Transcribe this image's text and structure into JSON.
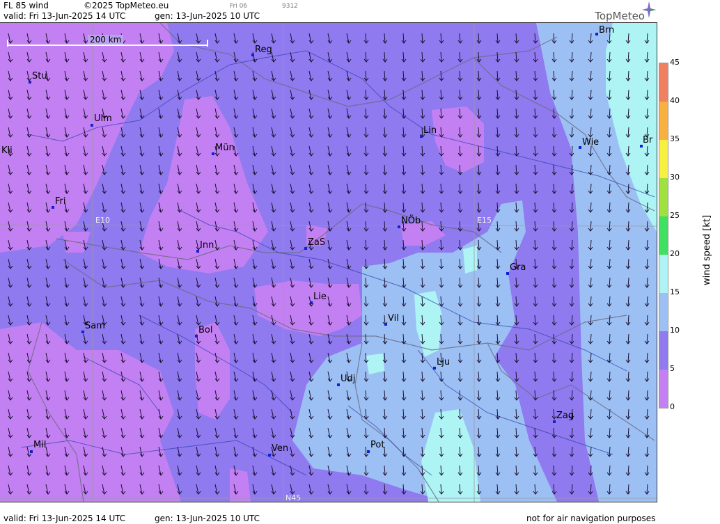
{
  "header": {
    "title": "FL 85 wind",
    "copyright": "©2025 TopMeteo.eu",
    "day_small": "Fri 06",
    "code_small": "9312",
    "valid": "valid:  Fri  13-Jun-2025  14 UTC",
    "gen": "gen: 13-Jun-2025 10 UTC",
    "brand": "TopMeteo"
  },
  "footer": {
    "valid": "valid:  Fri  13-Jun-2025  14 UTC",
    "gen": "gen: 13-Jun-2025 10 UTC",
    "disclaimer": "not for air navigation purposes"
  },
  "map": {
    "scale_label": "200 km",
    "grid_labels": {
      "e10": "E10",
      "e15": "E15",
      "n45": "N45"
    },
    "cities": [
      {
        "name": "Brn"
      },
      {
        "name": "Reg"
      },
      {
        "name": "Stu"
      },
      {
        "name": "Ulm"
      },
      {
        "name": "Kli"
      },
      {
        "name": "Mün"
      },
      {
        "name": "Lin"
      },
      {
        "name": "Wie"
      },
      {
        "name": "Br"
      },
      {
        "name": "Fri"
      },
      {
        "name": "NÖb"
      },
      {
        "name": "Inn"
      },
      {
        "name": "ZaS"
      },
      {
        "name": "Gra"
      },
      {
        "name": "Lie"
      },
      {
        "name": "Vil"
      },
      {
        "name": "Sam"
      },
      {
        "name": "Bol"
      },
      {
        "name": "Lju"
      },
      {
        "name": "Udj"
      },
      {
        "name": "Zag"
      },
      {
        "name": "Mil"
      },
      {
        "name": "Ven"
      },
      {
        "name": "Pot"
      }
    ],
    "colors": {
      "band_0_5": "#c380f2",
      "band_5_10": "#8f7af0",
      "band_10_15": "#9cc0f4",
      "band_15_20": "#aef4f4"
    }
  },
  "legend": {
    "title": "wind  speed  [kt]",
    "ticks": [
      "45",
      "40",
      "35",
      "30",
      "25",
      "20",
      "15",
      "10",
      "5",
      "0"
    ],
    "segments": [
      {
        "from": 40,
        "to": 45,
        "color": "#f08060"
      },
      {
        "from": 35,
        "to": 40,
        "color": "#f8b040"
      },
      {
        "from": 30,
        "to": 35,
        "color": "#f8f040"
      },
      {
        "from": 25,
        "to": 30,
        "color": "#a0e040"
      },
      {
        "from": 20,
        "to": 25,
        "color": "#40e060"
      },
      {
        "from": 15,
        "to": 20,
        "color": "#aef4f4"
      },
      {
        "from": 10,
        "to": 15,
        "color": "#9cc0f4"
      },
      {
        "from": 5,
        "to": 10,
        "color": "#8f7af0"
      },
      {
        "from": 0,
        "to": 5,
        "color": "#c380f2"
      }
    ]
  }
}
